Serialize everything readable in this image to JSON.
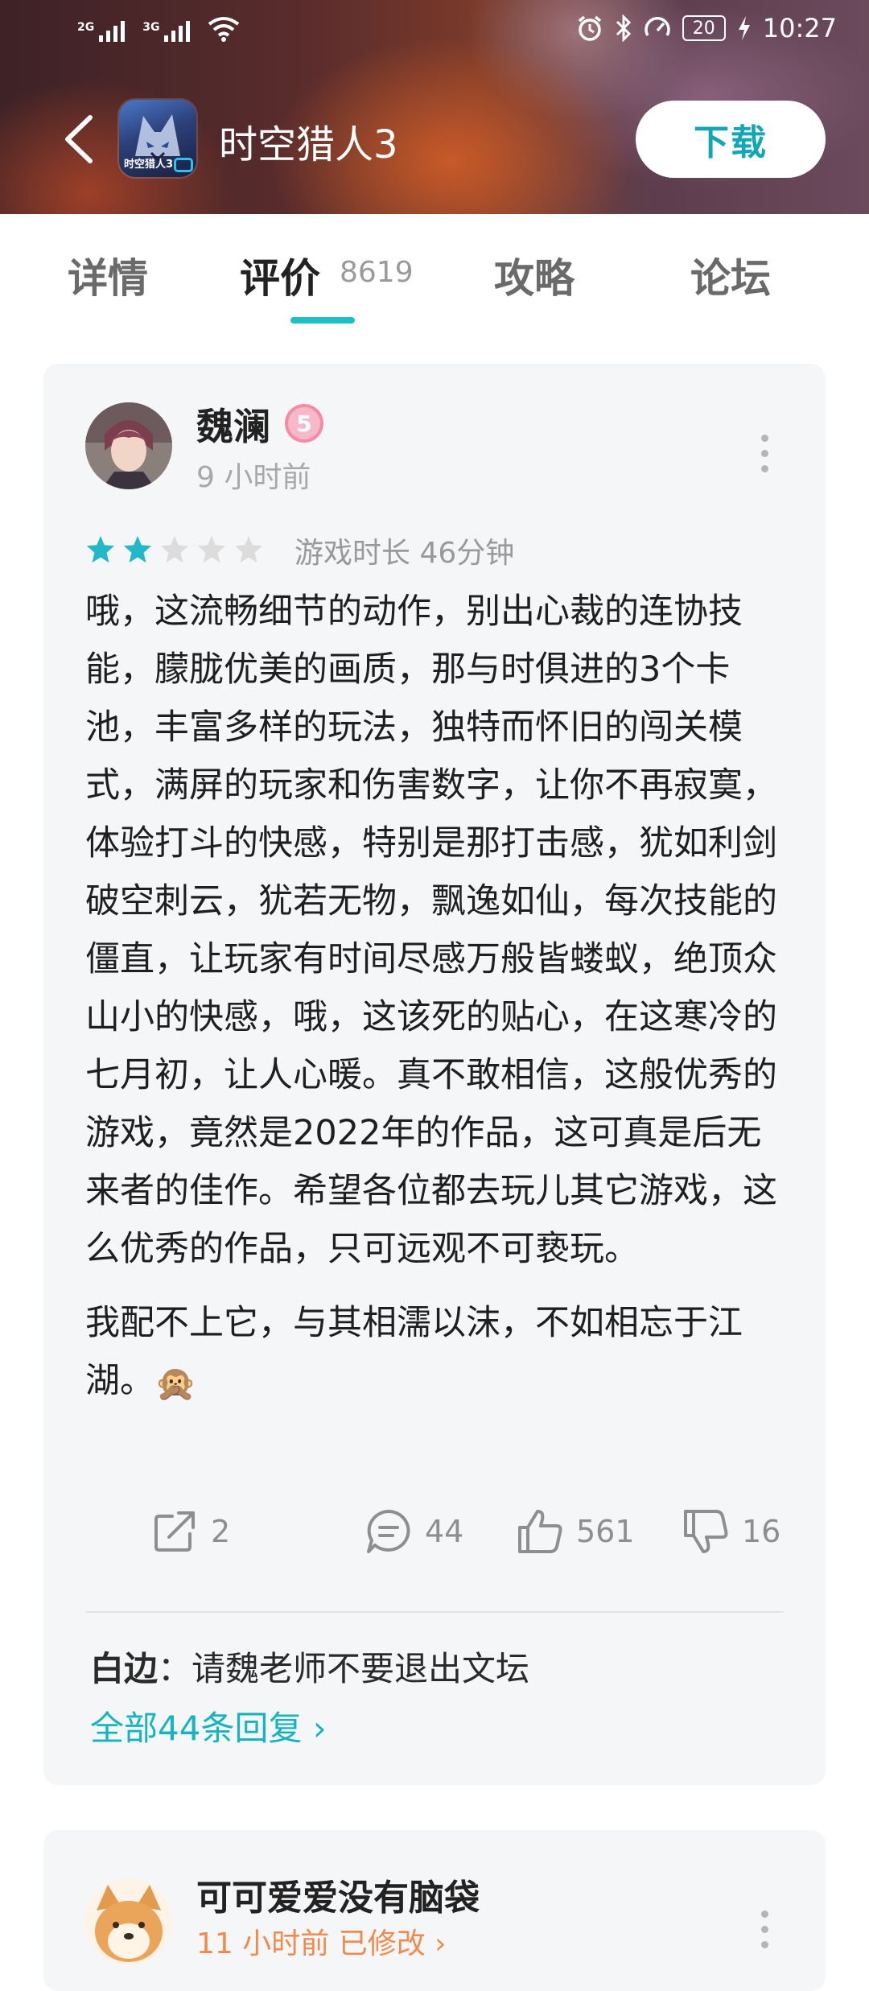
{
  "status_bar": {
    "signal1": "2G",
    "signal2": "3G",
    "battery": "20",
    "time": "10:27",
    "icons": [
      "wifi-icon",
      "alarm-icon",
      "bluetooth-icon",
      "speedometer-icon",
      "charging-icon"
    ]
  },
  "header": {
    "app_name": "时空猎人3",
    "icon_text": "时空猎人3",
    "download_label": "下载"
  },
  "tabs": [
    {
      "label": "详情"
    },
    {
      "label": "评价",
      "count": "8619",
      "active": true
    },
    {
      "label": "攻略"
    },
    {
      "label": "论坛"
    }
  ],
  "review": {
    "username": "魏澜",
    "level": "5",
    "time": "9 小时前",
    "rating": 2,
    "rating_max": 5,
    "playtime": "游戏时长 46分钟",
    "paragraph1": "哦，这流畅细节的动作，别出心裁的连协技能，朦胧优美的画质，那与时俱进的3个卡池，丰富多样的玩法，独特而怀旧的闯关模式，满屏的玩家和伤害数字，让你不再寂寞，体验打斗的快感，特别是那打击感，犹如利剑破空刺云，犹若无物，飘逸如仙，每次技能的僵直，让玩家有时间尽感万般皆蝼蚁，绝顶众山小的快感，哦，这该死的贴心，在这寒冷的七月初，让人心暖。真不敢相信，这般优秀的游戏，竟然是2022年的作品，这可真是后无来者的佳作。希望各位都去玩儿其它游戏，这么优秀的作品，只可远观不可亵玩。",
    "paragraph2": "我配不上它，与其相濡以沫，不如相忘于江湖。",
    "emoji": "🙊",
    "share_count": "2",
    "comment_count": "44",
    "like_count": "561",
    "dislike_count": "16",
    "reply_author": "白边",
    "reply_separator": "：",
    "reply_text": "请魏老师不要退出文坛",
    "all_replies_label": "全部44条回复",
    "all_replies_arrow": "›"
  },
  "review2": {
    "username": "可可爱爱没有脑袋",
    "time": "11 小时前 已修改 ›"
  },
  "colors": {
    "accent": "#1ec0c7",
    "star_filled": "#22b8c8",
    "star_empty": "#dcdcdc",
    "card_bg": "#f5f6f8"
  }
}
